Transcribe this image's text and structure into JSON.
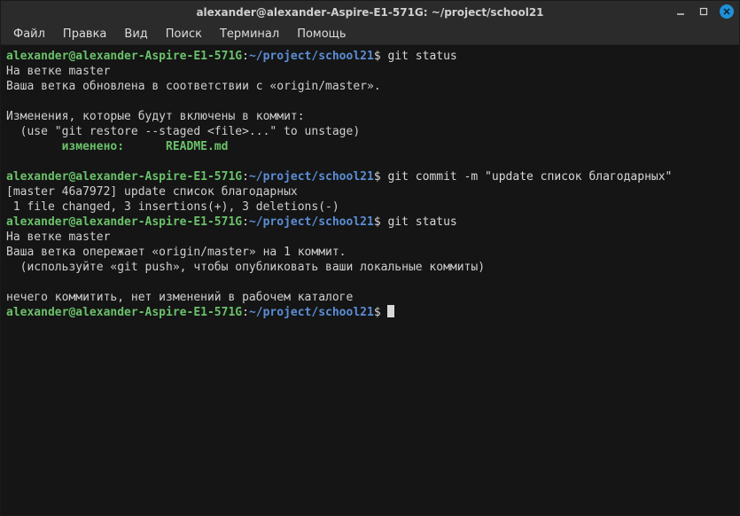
{
  "window": {
    "title": "alexander@alexander-Aspire-E1-571G: ~/project/school21"
  },
  "menubar": {
    "items": [
      "Файл",
      "Правка",
      "Вид",
      "Поиск",
      "Терминал",
      "Помощь"
    ]
  },
  "prompt": {
    "userhost": "alexander@alexander-Aspire-E1-571G",
    "colon": ":",
    "cwd": "~/project/school21",
    "dollar": "$ "
  },
  "lines": {
    "cmd1": "git status",
    "l1": "На ветке master",
    "l2": "Ваша ветка обновлена в соответствии с «origin/master».",
    "l3": "",
    "l4": "Изменения, которые будут включены в коммит:",
    "l5": "  (use \"git restore --staged <file>...\" to unstage)",
    "l6a": "        изменено:      ",
    "l6b": "README.md",
    "l7": "",
    "cmd2": "git commit -m \"update список благодарных\"",
    "l8": "[master 46a7972] update список благодарных",
    "l9": " 1 file changed, 3 insertions(+), 3 deletions(-)",
    "cmd3": "git status",
    "l10": "На ветке master",
    "l11": "Ваша ветка опережает «origin/master» на 1 коммит.",
    "l12": "  (используйте «git push», чтобы опубликовать ваши локальные коммиты)",
    "l13": "",
    "l14": "нечего коммитить, нет изменений в рабочем каталоге"
  }
}
